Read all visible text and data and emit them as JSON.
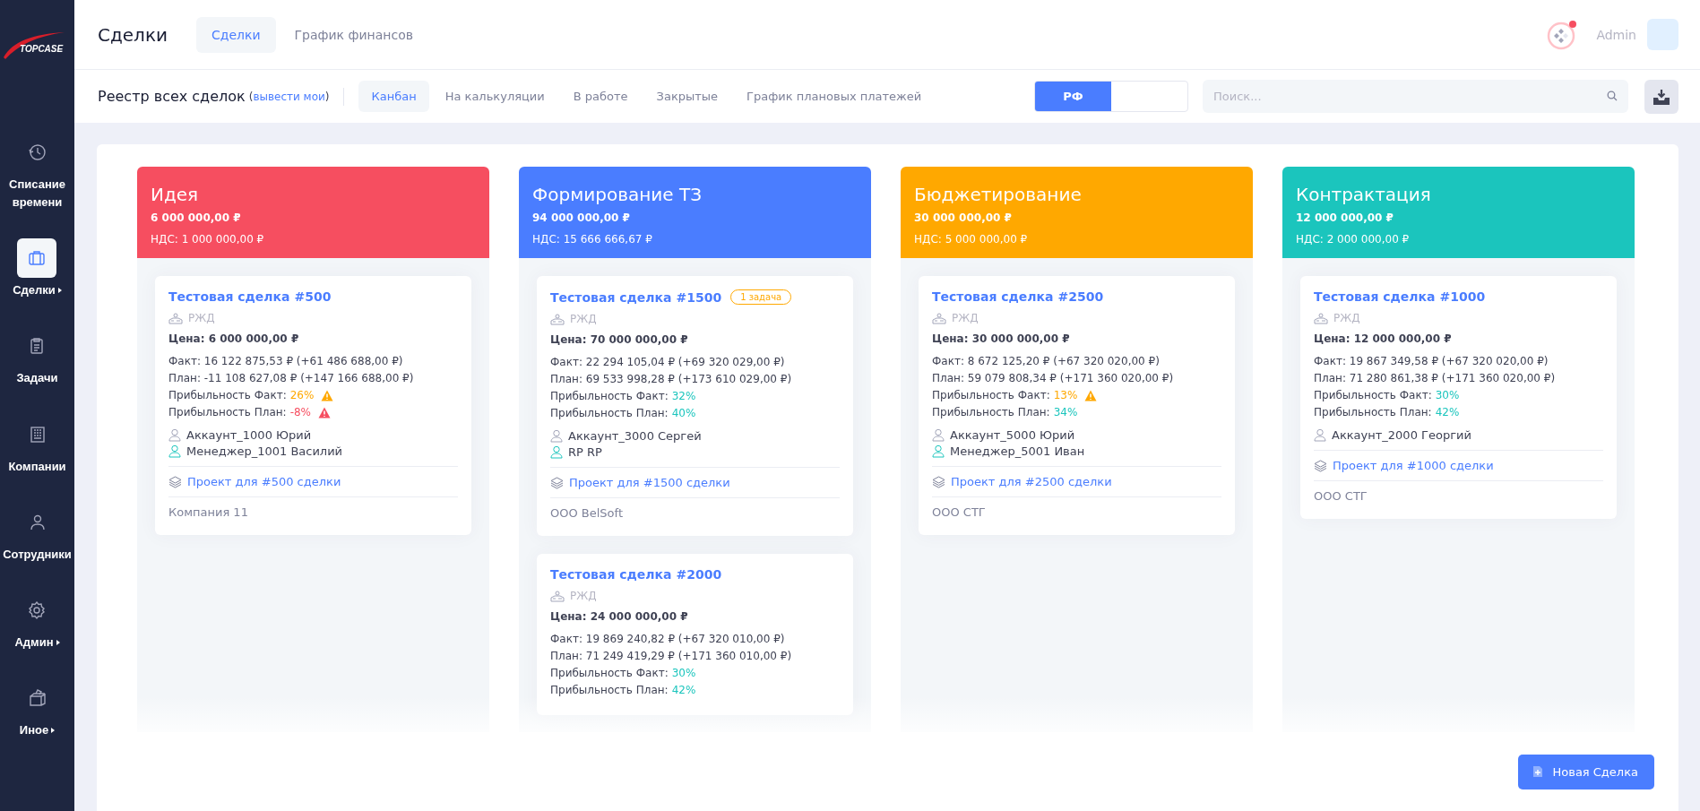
{
  "sidebar": {
    "logo": "TOPCASE",
    "items": [
      {
        "label": "Списание времени",
        "selected": false,
        "submenu": false
      },
      {
        "label": "Сделки",
        "selected": true,
        "submenu": true
      },
      {
        "label": "Задачи",
        "selected": false,
        "submenu": false
      },
      {
        "label": "Компании",
        "selected": false,
        "submenu": false
      },
      {
        "label": "Сотрудники",
        "selected": false,
        "submenu": false
      },
      {
        "label": "Админ",
        "selected": false,
        "submenu": true
      },
      {
        "label": "Иное",
        "selected": false,
        "submenu": true
      }
    ]
  },
  "header": {
    "title": "Сделки",
    "tabs": [
      {
        "label": "Сделки",
        "selected": true
      },
      {
        "label": "График финансов",
        "selected": false
      }
    ],
    "notification": true,
    "user": "Admin"
  },
  "subheader": {
    "title": "Реестр всех сделок",
    "paren_open": "(",
    "filter_link": "вывести мои",
    "paren_close": ")",
    "tabs": [
      {
        "label": "Канбан",
        "selected": true
      },
      {
        "label": "На калькуляции",
        "selected": false
      },
      {
        "label": "В работе",
        "selected": false
      },
      {
        "label": "Закрытые",
        "selected": false
      },
      {
        "label": "График плановых платежей",
        "selected": false
      }
    ],
    "toggle": {
      "label": "РФ",
      "on": true
    },
    "search": {
      "placeholder": "Поиск..."
    }
  },
  "columns": [
    {
      "title": "Идея",
      "total": "6 000 000,00 ₽",
      "vat": "НДС: 1 000 000,00 ₽",
      "color": "#f64e60",
      "cards": [
        {
          "title": "Тестовая сделка #500",
          "client": "РЖД",
          "price": "Цена: 6 000 000,00 ₽",
          "fact": "Факт: 16 122 875,53 ₽ (+61 486 688,00 ₽)",
          "plan": "План: -11 108 627,08 ₽ (+147 166 688,00 ₽)",
          "profit": [
            {
              "label": "Прибыльность Факт:",
              "value": "26%",
              "color": "#ffa800",
              "warning": true
            },
            {
              "label": "Прибыльность План:",
              "value": "-8%",
              "color": "#f64e60",
              "warning": true
            }
          ],
          "people": [
            {
              "kind": "account",
              "name": "Аккаунт_1000 Юрий"
            },
            {
              "kind": "manager",
              "name": "Менеджер_1001 Василий"
            }
          ],
          "project": "Проект для #500 сделки",
          "company": "Компания 11"
        }
      ]
    },
    {
      "title": "Формирование ТЗ",
      "total": "94 000 000,00 ₽",
      "vat": "НДС: 15 666 666,67 ₽",
      "color": "#4a7dff",
      "cards": [
        {
          "title": "Тестовая сделка #1500",
          "badge": "1 задача",
          "client": "РЖД",
          "price": "Цена: 70 000 000,00 ₽",
          "fact": "Факт: 22 294 105,04 ₽ (+69 320 029,00 ₽)",
          "plan": "План: 69 533 998,28 ₽ (+173 610 029,00 ₽)",
          "profit": [
            {
              "label": "Прибыльность Факт:",
              "value": "32%",
              "color": "#1bc5bd",
              "warning": false
            },
            {
              "label": "Прибыльность План:",
              "value": "40%",
              "color": "#1bc5bd",
              "warning": false
            }
          ],
          "people": [
            {
              "kind": "account",
              "name": "Аккаунт_3000 Сергей"
            },
            {
              "kind": "manager",
              "name": "RP RP"
            }
          ],
          "project": "Проект для #1500 сделки",
          "company": "ООО BelSoft"
        },
        {
          "title": "Тестовая сделка #2000",
          "client": "РЖД",
          "price": "Цена: 24 000 000,00 ₽",
          "fact": "Факт: 19 869 240,82 ₽ (+67 320 010,00 ₽)",
          "plan": "План: 71 249 419,29 ₽ (+171 360 010,00 ₽)",
          "profit": [
            {
              "label": "Прибыльность Факт:",
              "value": "30%",
              "color": "#1bc5bd",
              "warning": false
            },
            {
              "label": "Прибыльность План:",
              "value": "42%",
              "color": "#1bc5bd",
              "warning": false
            }
          ]
        }
      ]
    },
    {
      "title": "Бюджетирование",
      "total": "30 000 000,00 ₽",
      "vat": "НДС: 5 000 000,00 ₽",
      "color": "#ffa800",
      "cards": [
        {
          "title": "Тестовая сделка #2500",
          "client": "РЖД",
          "price": "Цена: 30 000 000,00 ₽",
          "fact": "Факт: 8 672 125,20 ₽ (+67 320 020,00 ₽)",
          "plan": "План: 59 079 808,34 ₽ (+171 360 020,00 ₽)",
          "profit": [
            {
              "label": "Прибыльность Факт:",
              "value": "13%",
              "color": "#ffa800",
              "warning": true
            },
            {
              "label": "Прибыльность План:",
              "value": "34%",
              "color": "#1bc5bd",
              "warning": false
            }
          ],
          "people": [
            {
              "kind": "account",
              "name": "Аккаунт_5000 Юрий"
            },
            {
              "kind": "manager",
              "name": "Менеджер_5001 Иван"
            }
          ],
          "project": "Проект для #2500 сделки",
          "company": "ООО СТГ"
        }
      ]
    },
    {
      "title": "Контрактация",
      "total": "12 000 000,00 ₽",
      "vat": "НДС: 2 000 000,00 ₽",
      "color": "#1bc5bd",
      "cards": [
        {
          "title": "Тестовая сделка #1000",
          "client": "РЖД",
          "price": "Цена: 12 000 000,00 ₽",
          "fact": "Факт: 19 867 349,58 ₽ (+67 320 020,00 ₽)",
          "plan": "План: 71 280 861,38 ₽ (+171 360 020,00 ₽)",
          "profit": [
            {
              "label": "Прибыльность Факт:",
              "value": "30%",
              "color": "#1bc5bd",
              "warning": false
            },
            {
              "label": "Прибыльность План:",
              "value": "42%",
              "color": "#1bc5bd",
              "warning": false
            }
          ],
          "people": [
            {
              "kind": "account",
              "name": "Аккаунт_2000 Георгий"
            }
          ],
          "project": "Проект для #1000 сделки",
          "company": "ООО СТГ"
        }
      ]
    }
  ],
  "new_deal_button": "Новая Сделка"
}
